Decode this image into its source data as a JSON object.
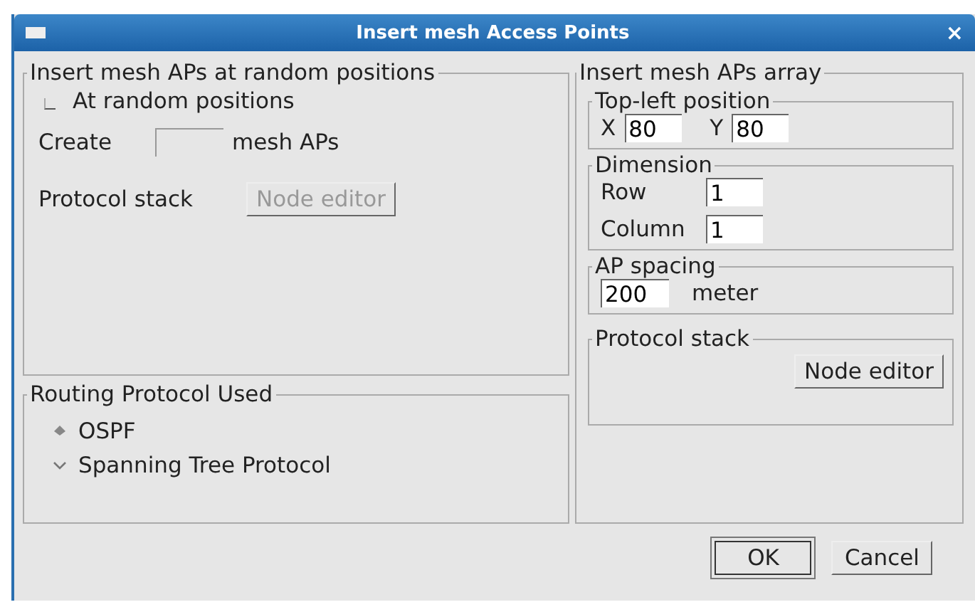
{
  "window": {
    "title": "Insert mesh Access Points",
    "close": "×"
  },
  "random": {
    "title": "Insert mesh APs at random positions",
    "checkbox": {
      "label": "At random positions",
      "checked": false
    },
    "create_label": "Create",
    "create_suffix": "mesh APs",
    "stack_label": "Protocol stack",
    "stack_button": {
      "label": "Node editor",
      "disabled": true
    }
  },
  "routing": {
    "title": "Routing Protocol Used",
    "options": [
      {
        "label": "OSPF",
        "selected": true
      },
      {
        "label": "Spanning Tree Protocol",
        "selected": false
      }
    ]
  },
  "array": {
    "title": "Insert mesh APs array",
    "position": {
      "title": "Top-left position",
      "x_label": "X",
      "x_value": "80",
      "y_label": "Y",
      "y_value": "80"
    },
    "dimension": {
      "title": "Dimension",
      "row_label": "Row",
      "row_value": "1",
      "column_label": "Column",
      "column_value": "1"
    },
    "spacing": {
      "title": "AP spacing",
      "value": "200",
      "unit": "meter"
    },
    "stack": {
      "title": "Protocol stack",
      "button": {
        "label": "Node editor",
        "disabled": false
      }
    }
  },
  "buttons": [
    {
      "label": "OK",
      "default": true
    },
    {
      "label": "Cancel",
      "default": false
    }
  ]
}
